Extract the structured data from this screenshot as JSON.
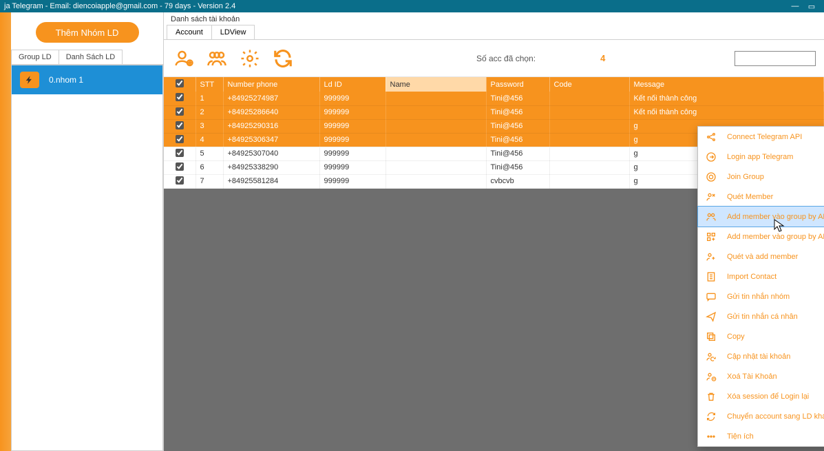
{
  "title": "ja Telegram - Email: diencoiapple@gmail.com - 79 days - Version 2.4",
  "sidebar": {
    "primary_btn": "Thêm Nhóm LD",
    "tabs": [
      "Group LD",
      "Danh Sách LD"
    ],
    "items": [
      {
        "label": "0.nhom 1"
      }
    ]
  },
  "main": {
    "section_title": "Danh sách tài khoản",
    "tabs": [
      "Account",
      "LDView"
    ],
    "acc_label": "Số acc đã chọn:",
    "acc_count": "4"
  },
  "columns": {
    "chk": "",
    "stt": "STT",
    "phone": "Number phone",
    "ld": "Ld ID",
    "name": "Name",
    "pass": "Password",
    "code": "Code",
    "msg": "Message"
  },
  "rows": [
    {
      "checked": true,
      "sel": true,
      "stt": "1",
      "phone": "+84925274987",
      "ld": "999999",
      "name": "",
      "pass": "Tini@456",
      "code": "",
      "msg": "Kết nối thành công"
    },
    {
      "checked": true,
      "sel": true,
      "stt": "2",
      "phone": "+84925286640",
      "ld": "999999",
      "name": "",
      "pass": "Tini@456",
      "code": "",
      "msg": "Kết nối thành công"
    },
    {
      "checked": true,
      "sel": true,
      "stt": "3",
      "phone": "+84925290316",
      "ld": "999999",
      "name": "",
      "pass": "Tini@456",
      "code": "",
      "msg": "g"
    },
    {
      "checked": true,
      "sel": true,
      "stt": "4",
      "phone": "+84925306347",
      "ld": "999999",
      "name": "",
      "pass": "Tini@456",
      "code": "",
      "msg": "g"
    },
    {
      "checked": true,
      "sel": false,
      "stt": "5",
      "phone": "+84925307040",
      "ld": "999999",
      "name": "",
      "pass": "Tini@456",
      "code": "",
      "msg": "g"
    },
    {
      "checked": true,
      "sel": false,
      "stt": "6",
      "phone": "+84925338290",
      "ld": "999999",
      "name": "",
      "pass": "Tini@456",
      "code": "",
      "msg": "g"
    },
    {
      "checked": true,
      "sel": false,
      "stt": "7",
      "phone": "+84925581284",
      "ld": "999999",
      "name": "",
      "pass": "cvbcvb",
      "code": "",
      "msg": "g"
    }
  ],
  "context_menu": [
    {
      "icon": "share",
      "label": "Connect Telegram API"
    },
    {
      "icon": "login",
      "label": "Login app Telegram"
    },
    {
      "icon": "join",
      "label": "Join Group"
    },
    {
      "icon": "scan",
      "label": "Quét Member"
    },
    {
      "icon": "add-api",
      "label": "Add member vào group by API",
      "highlight": true
    },
    {
      "icon": "add-app",
      "label": "Add member vào group by APP"
    },
    {
      "icon": "scan-add",
      "label": "Quét và add member"
    },
    {
      "icon": "import",
      "label": "Import Contact"
    },
    {
      "icon": "msg-group",
      "label": "Gửi tin nhắn nhóm"
    },
    {
      "icon": "msg-person",
      "label": "Gửi tin nhắn cá nhân"
    },
    {
      "icon": "copy",
      "label": "Copy"
    },
    {
      "icon": "update",
      "label": "Cập nhật tài khoản"
    },
    {
      "icon": "delete",
      "label": "Xoá Tài Khoản"
    },
    {
      "icon": "trash",
      "label": "Xóa session để Login lại"
    },
    {
      "icon": "transfer",
      "label": "Chuyển account sang LD khác"
    },
    {
      "icon": "more",
      "label": "Tiện ích",
      "submenu": true
    }
  ]
}
